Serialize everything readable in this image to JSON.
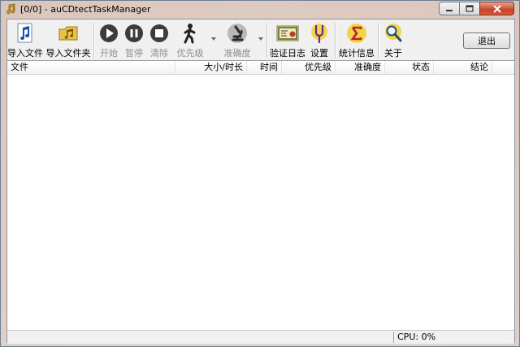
{
  "window": {
    "title": "[0/0] - auCDtectTaskManager"
  },
  "toolbar": {
    "import_file": "导入文件",
    "import_folder": "导入文件夹",
    "start": "开始",
    "pause": "暂停",
    "clear": "清除",
    "priority": "优先级",
    "accuracy": "准确度",
    "verify_log": "验证日志",
    "settings": "设置",
    "statistics": "统计信息",
    "about": "关于",
    "exit": "退出"
  },
  "list": {
    "columns": [
      "文件",
      "大小/时长",
      "时间",
      "优先级",
      "准确度",
      "状态",
      "结论"
    ]
  },
  "status": {
    "cpu": "CPU: 0%"
  },
  "colors": {
    "title_bar": "#e0cfc6",
    "close_button": "#c7452b",
    "toolbar_bg": "#f0f0f0"
  }
}
